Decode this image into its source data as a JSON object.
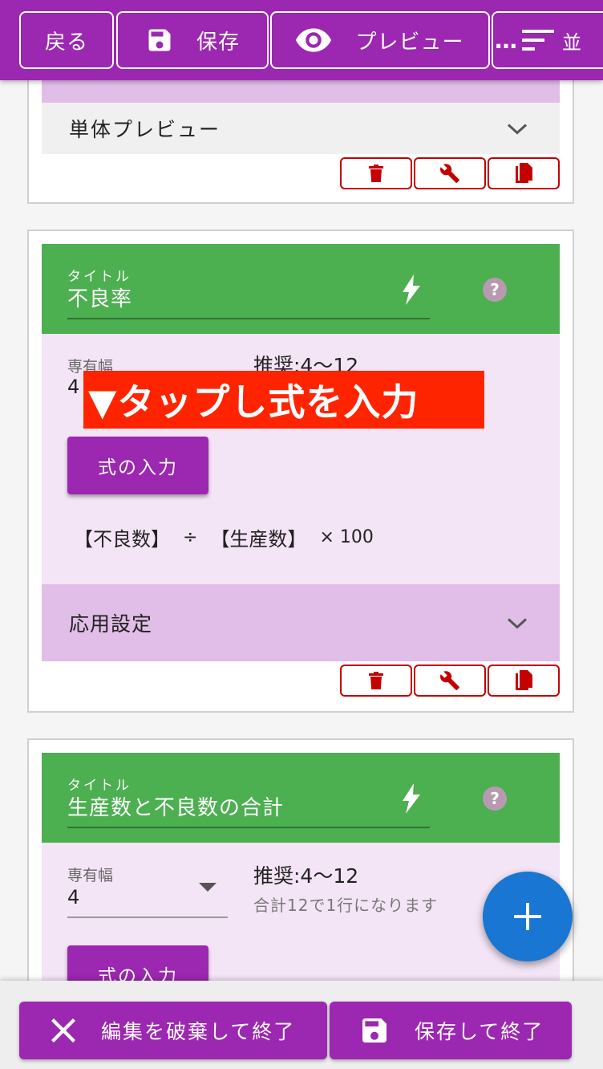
{
  "colors": {
    "primary": "#9c27b0",
    "header_green": "#4caf50",
    "danger": "#c40000",
    "fab_blue": "#1976d2",
    "banner_red": "#ff2400"
  },
  "toolbar": {
    "back_label": "戻る",
    "save_label": "保存",
    "preview_label": "プレビュー",
    "more_label": "…",
    "cut_label": "並"
  },
  "card_top": {
    "preview_label": "単体プレビュー"
  },
  "card_defect": {
    "title_label": "タイトル",
    "title_value": "不良率",
    "width_label": "専有幅",
    "width_value": "4",
    "recommend": "推奨:4〜12",
    "formula_button": "式の入力",
    "formula": {
      "operand1": "【不良数】",
      "op1": "÷",
      "operand2": "【生産数】",
      "op2": "× 100"
    },
    "advanced_label": "応用設定"
  },
  "card_total": {
    "title_label": "タイトル",
    "title_value": "生産数と不良数の合計",
    "width_label": "専有幅",
    "width_value": "4",
    "recommend": "推奨:4〜12",
    "recommend_note": "合計12で1行になります",
    "formula_button": "式の入力"
  },
  "annotation_banner": "▼タップし式を入力",
  "bottom": {
    "discard_label": "編集を破棄して終了",
    "save_exit_label": "保存して終了"
  },
  "icons": [
    "save-icon",
    "eye-icon",
    "sort-icon",
    "chevron-down-icon",
    "trash-icon",
    "wrench-icon",
    "copy-icon",
    "bolt-icon",
    "help-icon",
    "plus-icon",
    "close-icon"
  ]
}
